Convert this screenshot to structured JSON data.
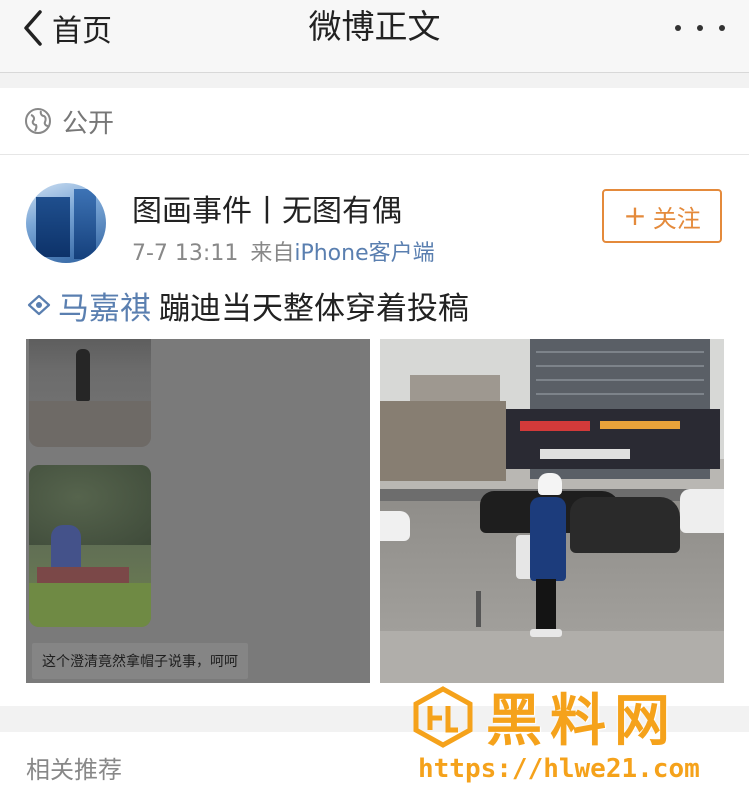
{
  "nav": {
    "back_label": "首页",
    "title": "微博正文",
    "back_icon": "chevron-left-icon",
    "more_icon": "more-dots-icon"
  },
  "privacy": {
    "icon": "globe-icon",
    "label": "公开"
  },
  "post": {
    "author": "图画事件丨无图有偶",
    "time": "7-7 13:11",
    "source_prefix": "来自",
    "source": "iPhone客户端",
    "follow_label": "关注",
    "topic_icon": "super-topic-icon",
    "topic": "马嘉祺",
    "text": "蹦迪当天整体穿着投稿",
    "image1_caption": "这个澄清竟然拿帽子说事，呵呵"
  },
  "related": {
    "label": "相关推荐"
  },
  "watermark": {
    "title": "黑料网",
    "url": "https://hlwe21.com"
  },
  "colors": {
    "accent_orange": "#e48a3b",
    "link_blue": "#5a7fb0",
    "watermark_orange": "#f5a21b"
  }
}
